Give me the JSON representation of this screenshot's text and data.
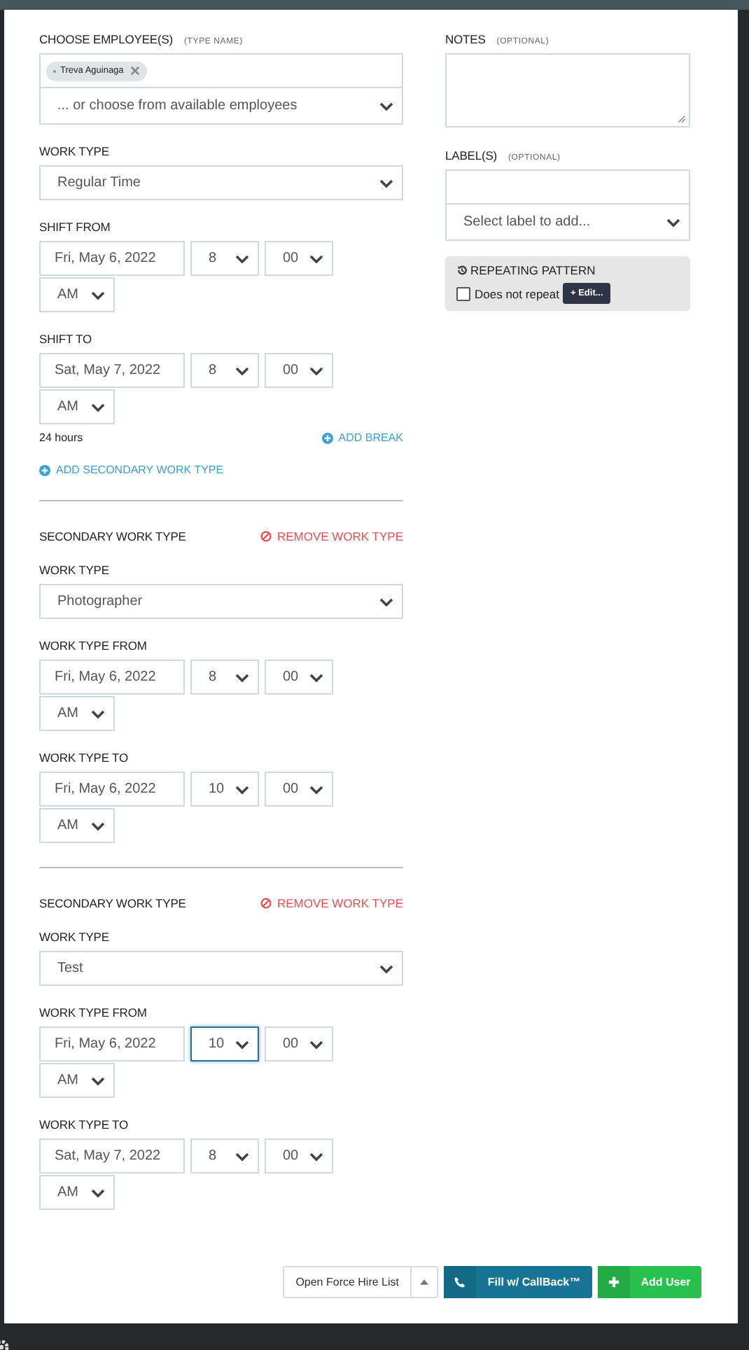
{
  "employees": {
    "label": "CHOOSE EMPLOYEE(S)",
    "hint": "(TYPE NAME)",
    "tags": [
      {
        "name": "Treva Aguinaga"
      }
    ],
    "chooser": "... or choose from available employees"
  },
  "work_type": {
    "label": "WORK TYPE",
    "value": "Regular Time"
  },
  "shift_from": {
    "label": "SHIFT FROM",
    "date": "Fri, May 6, 2022",
    "hour": "8",
    "minute": "00",
    "ampm": "AM",
    "hour_focused": false
  },
  "shift_to": {
    "label": "SHIFT TO",
    "date": "Sat, May 7, 2022",
    "hour": "8",
    "minute": "00",
    "ampm": "AM",
    "hour_focused": false
  },
  "duration": "24 hours",
  "add_break": "ADD BREAK",
  "add_secondary": "ADD SECONDARY WORK TYPE",
  "secondary_work_types": [
    {
      "title": "SECONDARY WORK TYPE",
      "remove": "REMOVE WORK TYPE",
      "work_type": {
        "label": "WORK TYPE",
        "value": "Photographer"
      },
      "from": {
        "label": "WORK TYPE FROM",
        "date": "Fri, May 6, 2022",
        "hour": "8",
        "minute": "00",
        "ampm": "AM",
        "hour_focused": false
      },
      "to": {
        "label": "WORK TYPE TO",
        "date": "Fri, May 6, 2022",
        "hour": "10",
        "minute": "00",
        "ampm": "AM",
        "hour_focused": false
      }
    },
    {
      "title": "SECONDARY WORK TYPE",
      "remove": "REMOVE WORK TYPE",
      "work_type": {
        "label": "WORK TYPE",
        "value": "Test"
      },
      "from": {
        "label": "WORK TYPE FROM",
        "date": "Fri, May 6, 2022",
        "hour": "10",
        "minute": "00",
        "ampm": "AM",
        "hour_focused": true
      },
      "to": {
        "label": "WORK TYPE TO",
        "date": "Sat, May 7, 2022",
        "hour": "8",
        "minute": "00",
        "ampm": "AM",
        "hour_focused": false
      }
    }
  ],
  "notes": {
    "label": "NOTES",
    "hint": "(OPTIONAL)"
  },
  "labels": {
    "label": "LABEL(S)",
    "hint": "(OPTIONAL)",
    "select": "Select label to add..."
  },
  "repeating": {
    "title": "REPEATING PATTERN",
    "checked": false,
    "text": "Does not repeat",
    "edit": "+ Edit..."
  },
  "footer": {
    "force_hire": "Open Force Hire List",
    "callback": "Fill w/ CallBack™",
    "add_user": "Add User"
  }
}
